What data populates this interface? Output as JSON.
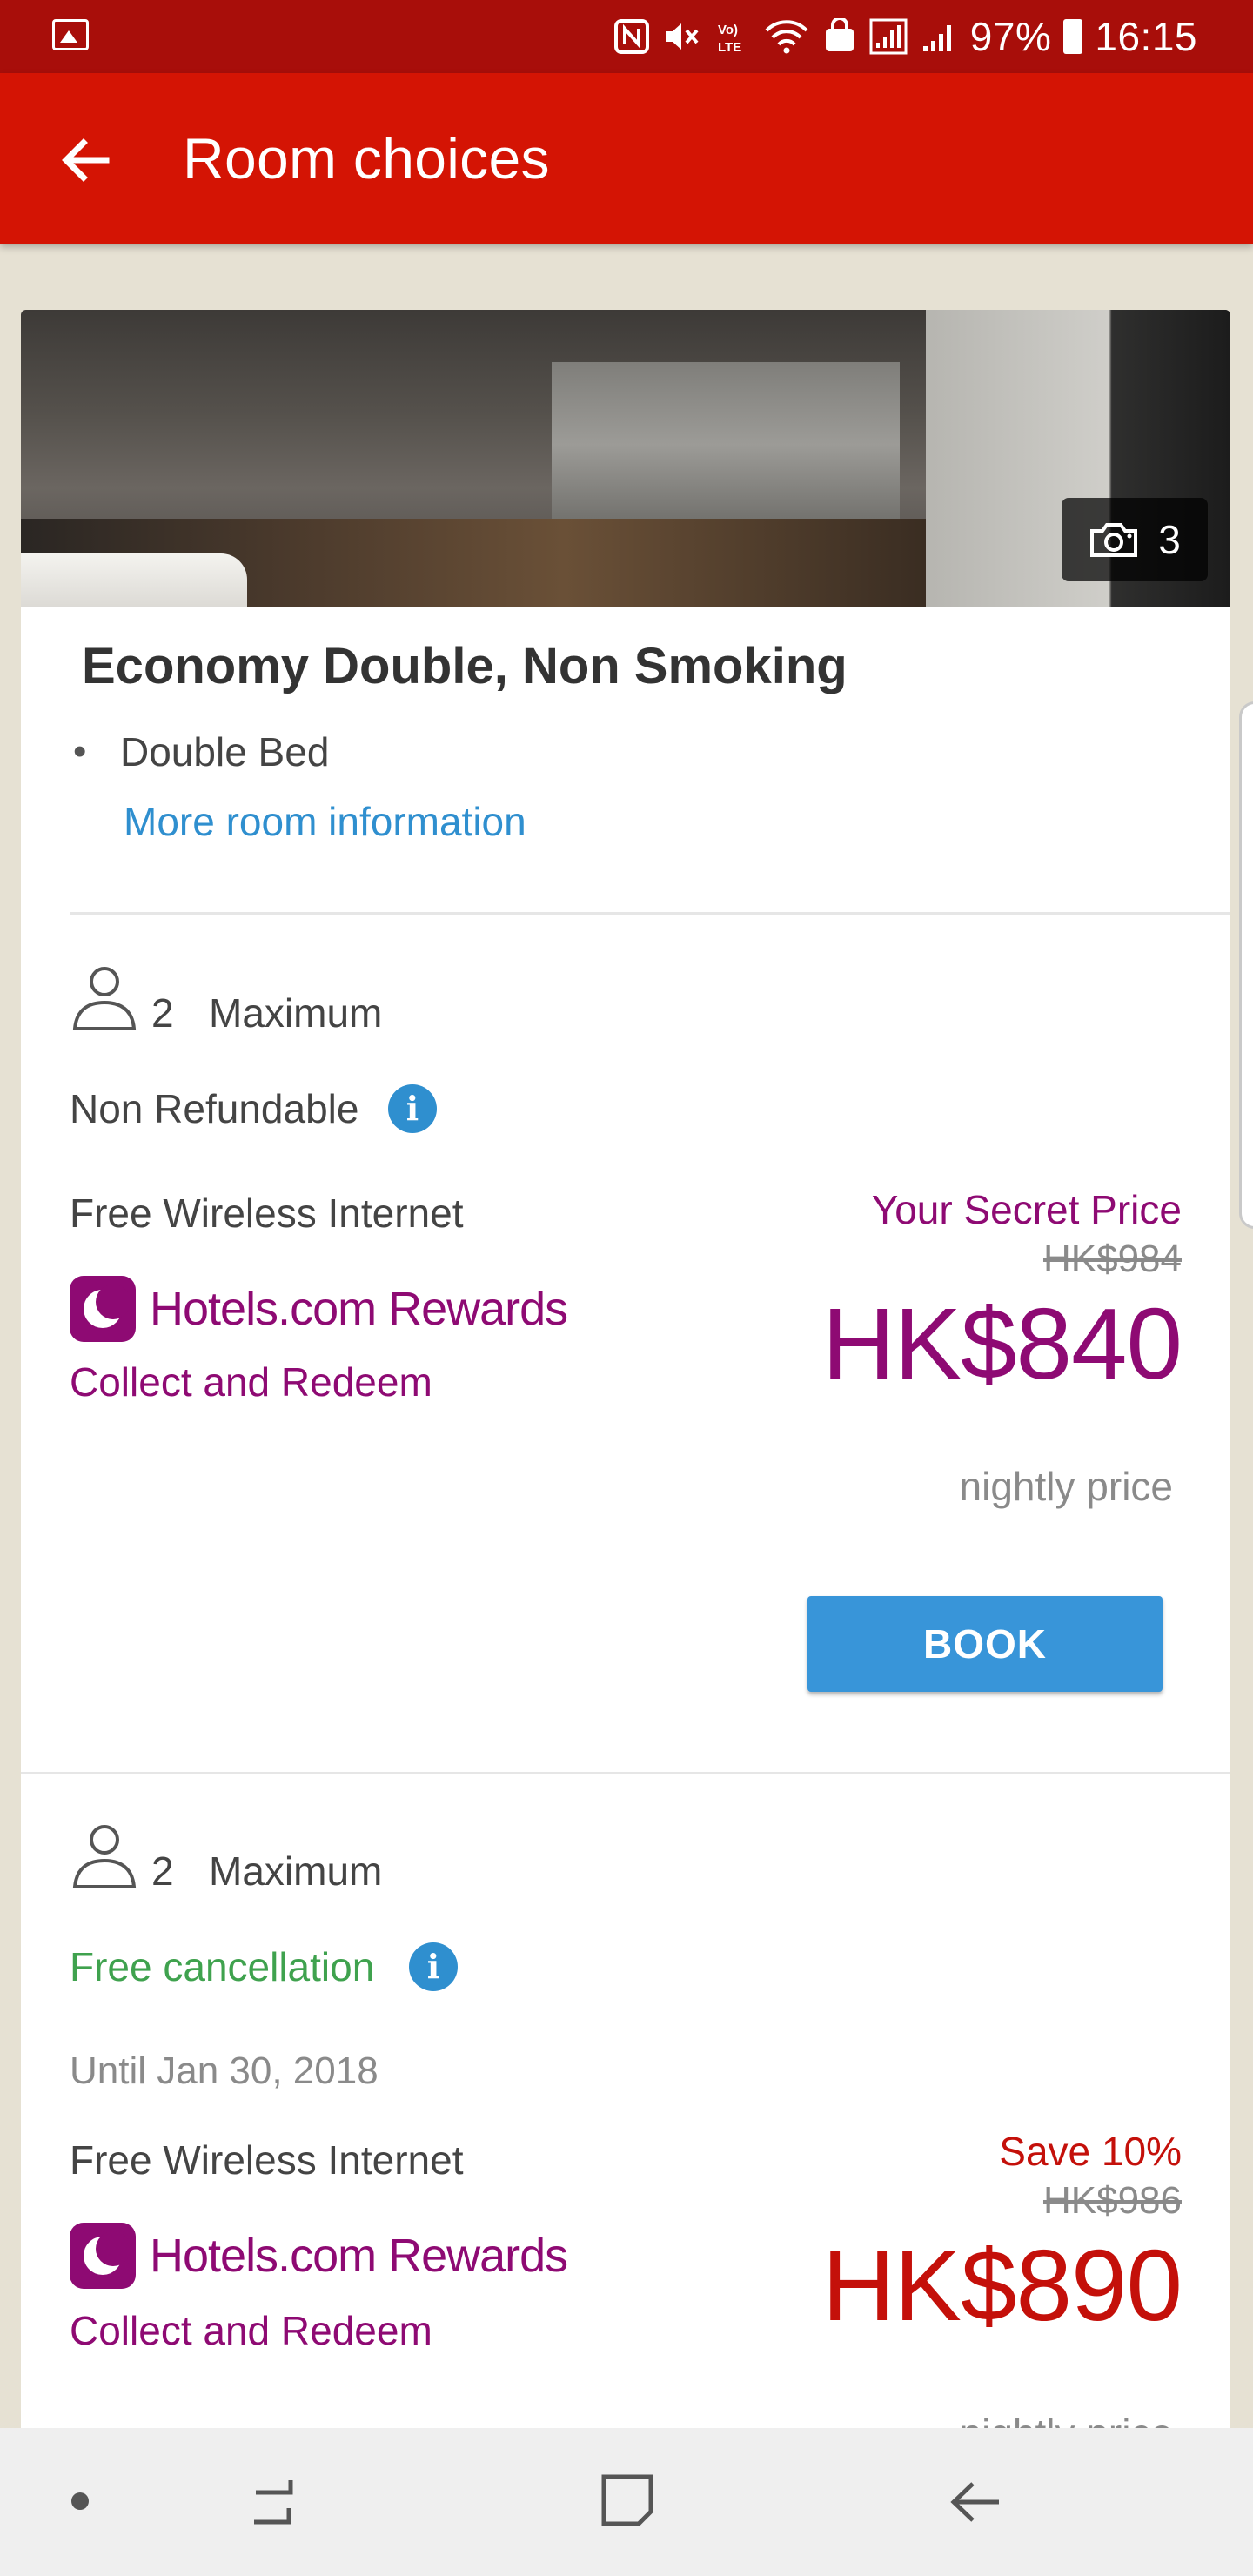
{
  "status_bar": {
    "battery": "97%",
    "time": "16:15",
    "icons": [
      "gallery-icon",
      "nfc-icon",
      "mute-icon",
      "volte-icon",
      "wifi-icon",
      "signal-icon",
      "battery-icon"
    ]
  },
  "app_bar": {
    "title": "Room choices",
    "back_icon": "arrow-left-icon"
  },
  "room": {
    "photo_count": "3",
    "name": "Economy Double, Non Smoking",
    "bed": "Double Bed",
    "more_info_label": "More room information"
  },
  "rates": [
    {
      "occupancy_number": "2",
      "occupancy_label": "Maximum",
      "refund_policy": "Non Refundable",
      "amenity": "Free Wireless Internet",
      "rewards_brand": "Hotels.com Rewards",
      "rewards_label": "Collect and Redeem",
      "promo_label": "Your Secret Price",
      "original_price": "HK$984",
      "price": "HK$840",
      "price_note": "nightly price",
      "book_label": "BOOK"
    },
    {
      "occupancy_number": "2",
      "occupancy_label": "Maximum",
      "refund_policy": "Free cancellation",
      "cancellation_until": "Until Jan 30, 2018",
      "amenity": "Free Wireless Internet",
      "rewards_brand": "Hotels.com Rewards",
      "rewards_label": "Collect and Redeem",
      "promo_label": "Save 10%",
      "original_price": "HK$986",
      "price": "HK$890",
      "price_note": "nightly price"
    }
  ],
  "colors": {
    "status_bar": "#a80e0a",
    "app_bar": "#d41404",
    "secret_price": "#8e0a73",
    "save_price": "#c4100a",
    "link": "#2f8fcf",
    "book_button": "#3895d9",
    "free_cancellation": "#3fa24e"
  }
}
